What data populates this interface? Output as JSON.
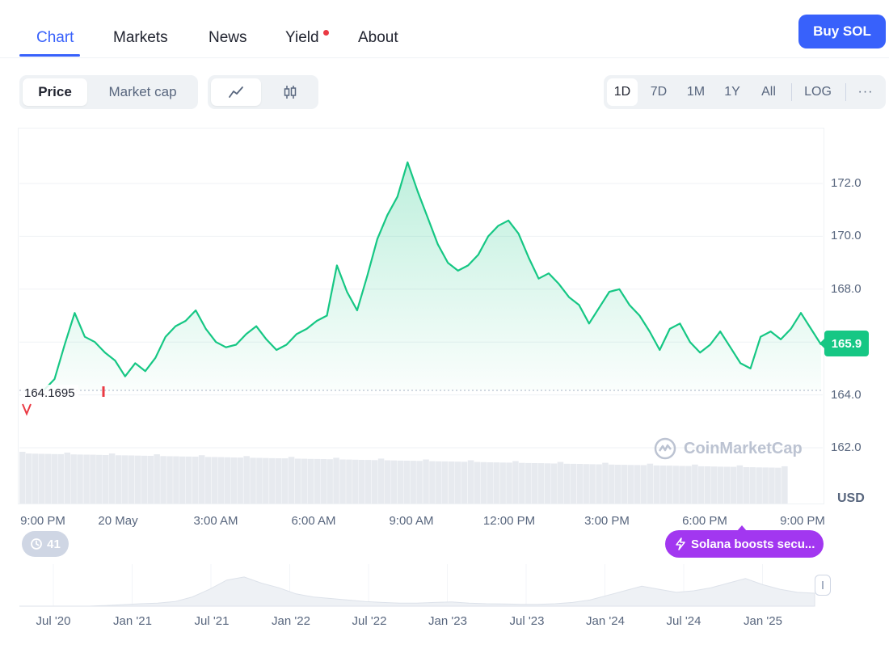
{
  "nav": {
    "tabs": [
      {
        "label": "Chart"
      },
      {
        "label": "Markets"
      },
      {
        "label": "News"
      },
      {
        "label": "Yield"
      },
      {
        "label": "About"
      }
    ],
    "buy_label": "Buy SOL"
  },
  "toolbar": {
    "metric_tabs": [
      "Price",
      "Market cap"
    ],
    "chart_type_icons": [
      "line-chart-icon",
      "candlestick-icon"
    ],
    "ranges": [
      "1D",
      "7D",
      "1M",
      "1Y",
      "All"
    ],
    "log_label": "LOG",
    "more_label": "···"
  },
  "chart": {
    "currency": "USD",
    "current_price": "165.9",
    "low_label": "164.1695",
    "watermark": "CoinMarketCap",
    "colors": {
      "line": "#16c784",
      "accent": "#3861fb",
      "down": "#ea3943",
      "news": "#a237f0"
    }
  },
  "history_badge": {
    "count": "41"
  },
  "news_pill": {
    "label": "Solana boosts secu..."
  },
  "chart_data": {
    "type": "area",
    "ylim": [
      161.0,
      174.0
    ],
    "y_ticks": [
      162.0,
      164.0,
      166.0,
      168.0,
      170.0,
      172.0
    ],
    "x_ticks": [
      "9:00 PM",
      "20 May",
      "3:00 AM",
      "6:00 AM",
      "9:00 AM",
      "12:00 PM",
      "3:00 PM",
      "6:00 PM",
      "9:00 PM"
    ],
    "grid": true,
    "series": [
      {
        "values": [
          164.2,
          164.6,
          165.9,
          167.1,
          166.2,
          166.0,
          165.6,
          165.3,
          164.7,
          165.2,
          164.9,
          165.4,
          166.2,
          166.6,
          166.8,
          167.2,
          166.5,
          166.0,
          165.8,
          165.9,
          166.3,
          166.6,
          166.1,
          165.7,
          165.9,
          166.3,
          166.5,
          166.8,
          167.0,
          168.9,
          167.9,
          167.2,
          168.5,
          169.9,
          170.8,
          171.5,
          172.8,
          171.7,
          170.7,
          169.7,
          169.0,
          168.7,
          168.9,
          169.3,
          170.0,
          170.4,
          170.6,
          170.1,
          169.2,
          168.4,
          168.6,
          168.2,
          167.7,
          167.4,
          166.7,
          167.3,
          167.9,
          168.0,
          167.4,
          167.0,
          166.4,
          165.7,
          166.5,
          166.7,
          166.0,
          165.6,
          165.9,
          166.4,
          165.8,
          165.2,
          165.0,
          166.2,
          166.4,
          166.1,
          166.5,
          167.1,
          166.5,
          165.9
        ]
      }
    ],
    "volume_type": "bar",
    "navigator": {
      "type": "area",
      "x_ticks": [
        "Jul '20",
        "Jan '21",
        "Jul '21",
        "Jan '22",
        "Jul '22",
        "Jan '23",
        "Jul '23",
        "Jan '24",
        "Jul '24",
        "Jan '25"
      ]
    }
  }
}
